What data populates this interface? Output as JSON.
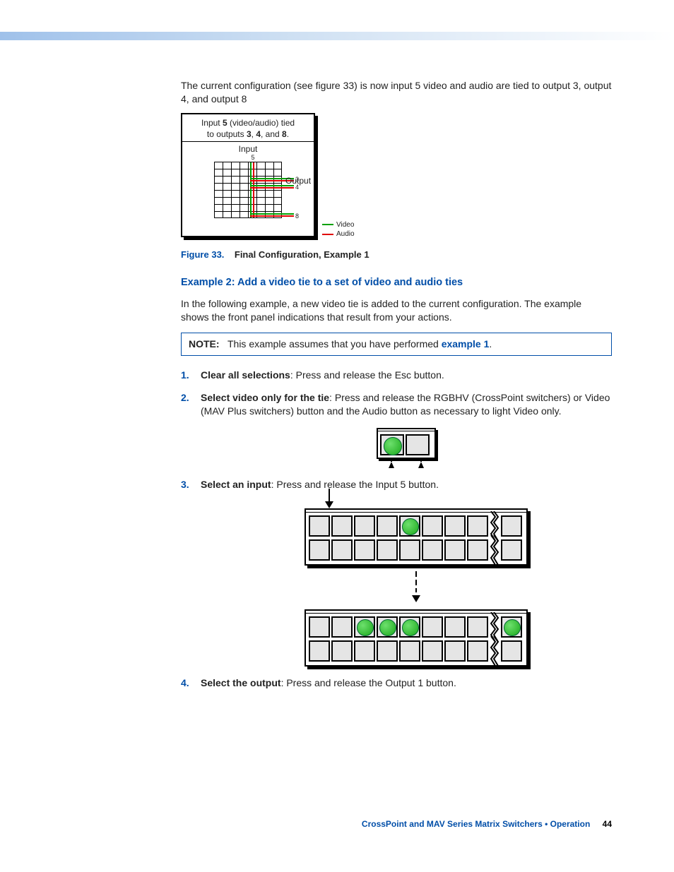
{
  "intro_paragraph": "The current configuration (see figure 33) is now input 5 video and audio are tied to output 3, output 4, and output 8",
  "figure33": {
    "box_line1_pre": "Input ",
    "box_line1_bold": "5",
    "box_line1_mid": " (video/audio) tied",
    "box_line2_pre": "to outputs ",
    "box_line2_b1": "3",
    "box_line2_c1": ", ",
    "box_line2_b2": "4",
    "box_line2_c2": ", and ",
    "box_line2_b3": "8",
    "box_line2_end": ".",
    "input_label": "Input",
    "tick5": "5",
    "out3": "3",
    "out4": "4",
    "out8": "8",
    "output_label": "Output",
    "legend_video": "Video",
    "legend_audio": "Audio",
    "caption_num": "Figure 33.",
    "caption_title": "Final Configuration, Example 1"
  },
  "example2": {
    "heading": "Example 2: Add a video tie to a set of video and audio ties",
    "para": "In the following example, a new video tie is added to the current configuration. The example shows the front panel indications that result from your actions.",
    "note_label": "NOTE:",
    "note_text_pre": "This example assumes that you have performed ",
    "note_link": "example 1",
    "note_text_post": "."
  },
  "steps": [
    {
      "num": "1",
      "title": "Clear all selections",
      "text": ": Press and release the Esc button."
    },
    {
      "num": "2",
      "title": "Select video only for the tie",
      "text": ": Press and release the RGBHV (CrossPoint switchers) or Video (MAV Plus switchers) button and the Audio button as necessary to light Video only."
    },
    {
      "num": "3",
      "title": "Select an input",
      "text": ": Press and release the Input 5 button."
    },
    {
      "num": "4",
      "title": "Select the output",
      "text": ": Press and release the Output 1 button."
    }
  ],
  "panels": {
    "a_lit": [
      false,
      false,
      false,
      false,
      true,
      false,
      false,
      false
    ],
    "a_extra_lit": false,
    "b_lit_top": [
      false,
      false,
      true,
      true,
      true,
      false,
      false,
      false
    ],
    "b_extra_top_lit": true
  },
  "footer": {
    "doc": "CrossPoint and MAV Series Matrix Switchers • Operation",
    "page": "44"
  }
}
